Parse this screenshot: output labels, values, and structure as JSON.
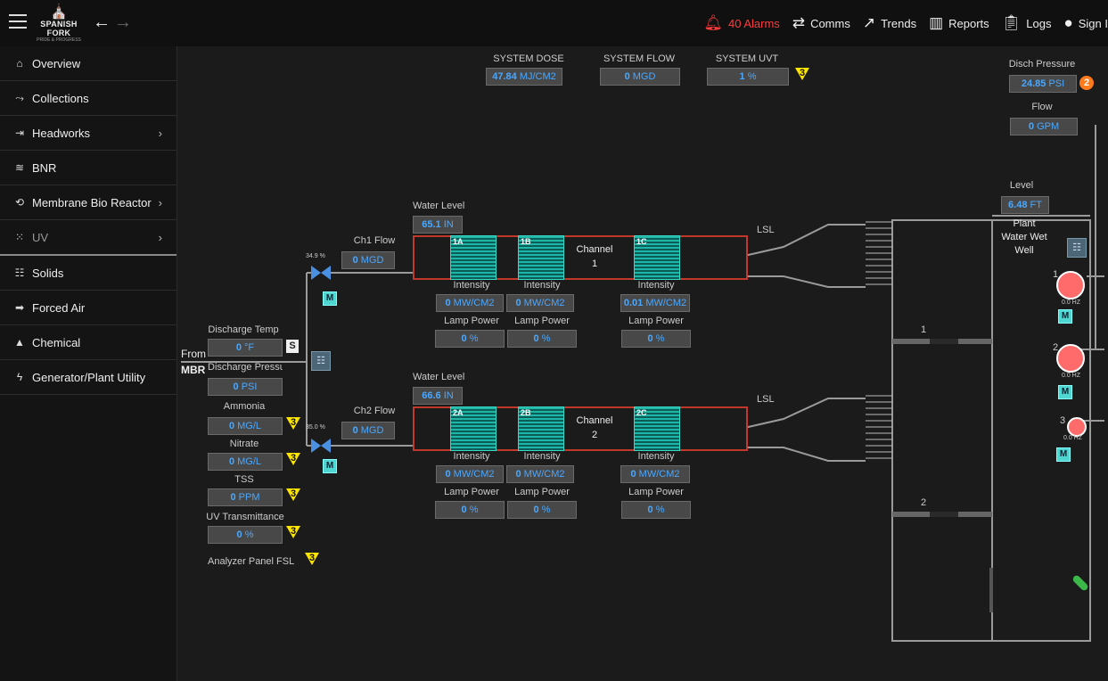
{
  "header": {
    "logo_name": "SPANISH FORK",
    "logo_tag": "PRIDE & PROGRESS",
    "alarms": "40 Alarms",
    "comms": "Comms",
    "trends": "Trends",
    "reports": "Reports",
    "logs": "Logs",
    "signin": "Sign I"
  },
  "sidebar": {
    "items": [
      {
        "label": "Overview"
      },
      {
        "label": "Collections"
      },
      {
        "label": "Headworks"
      },
      {
        "label": "BNR"
      },
      {
        "label": "Membrane Bio Reactor"
      },
      {
        "label": "UV"
      },
      {
        "label": "Solids"
      },
      {
        "label": "Forced Air"
      },
      {
        "label": "Chemical"
      },
      {
        "label": "Generator/Plant Utility"
      }
    ]
  },
  "system": {
    "dose_label": "SYSTEM DOSE",
    "dose_value": "47.84",
    "dose_unit": "MJ/CM2",
    "flow_label": "SYSTEM FLOW",
    "flow_value": "0",
    "flow_unit": "MGD",
    "uvt_label": "SYSTEM UVT",
    "uvt_value": "1",
    "uvt_unit": "%",
    "uvt_alarm": "3"
  },
  "left_panel": {
    "discharge_temp_label": "Discharge Temp",
    "discharge_temp_value": "0",
    "discharge_temp_unit": "°F",
    "s_badge": "S",
    "from": "From",
    "mbr": "MBR",
    "discharge_pressure_label": "Discharge Pressure",
    "discharge_pressure_value": "0",
    "discharge_pressure_unit": "PSI",
    "ammonia_label": "Ammonia",
    "ammonia_value": "0",
    "ammonia_unit": "MG/L",
    "ammonia_alarm": "3",
    "nitrate_label": "Nitrate",
    "nitrate_value": "0",
    "nitrate_unit": "MG/L",
    "nitrate_alarm": "3",
    "tss_label": "TSS",
    "tss_value": "0",
    "tss_unit": "PPM",
    "tss_alarm": "3",
    "uvt_label": "UV Transmittance",
    "uvt_value": "0",
    "uvt_unit": "%",
    "uvt_alarm": "3",
    "analyzer_label": "Analyzer Panel FSL",
    "analyzer_alarm": "3"
  },
  "channel1": {
    "valve_pct": "34.9 %",
    "m_badge": "M",
    "flow_label": "Ch1 Flow",
    "flow_value": "0",
    "flow_unit": "MGD",
    "level_label": "Water Level",
    "level_value": "65.1",
    "level_unit": "IN",
    "name": "Channel",
    "number": "1",
    "lamps": [
      "1A",
      "1B",
      "1C"
    ],
    "intensity_label": "Intensity",
    "lamp_power_label": "Lamp Power",
    "intensity": [
      {
        "value": "0",
        "unit": "MW/CM2"
      },
      {
        "value": "0",
        "unit": "MW/CM2"
      },
      {
        "value": "0.01",
        "unit": "MW/CM2"
      }
    ],
    "power": [
      {
        "value": "0",
        "unit": "%"
      },
      {
        "value": "0",
        "unit": "%"
      },
      {
        "value": "0",
        "unit": "%"
      }
    ],
    "lsl": "LSL"
  },
  "channel2": {
    "valve_pct": "35.0 %",
    "m_badge": "M",
    "flow_label": "Ch2 Flow",
    "flow_value": "0",
    "flow_unit": "MGD",
    "level_label": "Water Level",
    "level_value": "66.6",
    "level_unit": "IN",
    "name": "Channel",
    "number": "2",
    "lamps": [
      "2A",
      "2B",
      "2C"
    ],
    "intensity_label": "Intensity",
    "lamp_power_label": "Lamp Power",
    "intensity": [
      {
        "value": "0",
        "unit": "MW/CM2"
      },
      {
        "value": "0",
        "unit": "MW/CM2"
      },
      {
        "value": "0",
        "unit": "MW/CM2"
      }
    ],
    "power": [
      {
        "value": "0",
        "unit": "%"
      },
      {
        "value": "0",
        "unit": "%"
      },
      {
        "value": "0",
        "unit": "%"
      }
    ],
    "lsl": "LSL"
  },
  "right_panel": {
    "disch_pressure_label": "Disch Pressure",
    "disch_pressure_value": "24.85",
    "disch_pressure_unit": "PSI",
    "disch_pressure_alarm": "2",
    "flow_label": "Flow",
    "flow_value": "0",
    "flow_unit": "GPM",
    "level_label": "Level",
    "level_value": "6.48",
    "level_unit": "FT",
    "wetwell_line1": "Plant",
    "wetwell_line2": "Water Wet",
    "wetwell_line3": "Well",
    "gate1": "1",
    "gate2": "2",
    "pumps": [
      {
        "num": "1",
        "hz": "0.0 HZ",
        "mode": "M"
      },
      {
        "num": "2",
        "hz": "0.0 HZ",
        "mode": "M"
      },
      {
        "num": "3",
        "hz": "0.0 HZ",
        "mode": "M"
      }
    ]
  },
  "colors": {
    "accent_value": "#4aa8ff",
    "alarm_red": "#ff3b3b",
    "warning_yellow": "#ffe600",
    "lamp_teal": "#1fb5a7",
    "channel_border": "#c0392b",
    "pump": "#ff6b6b"
  }
}
